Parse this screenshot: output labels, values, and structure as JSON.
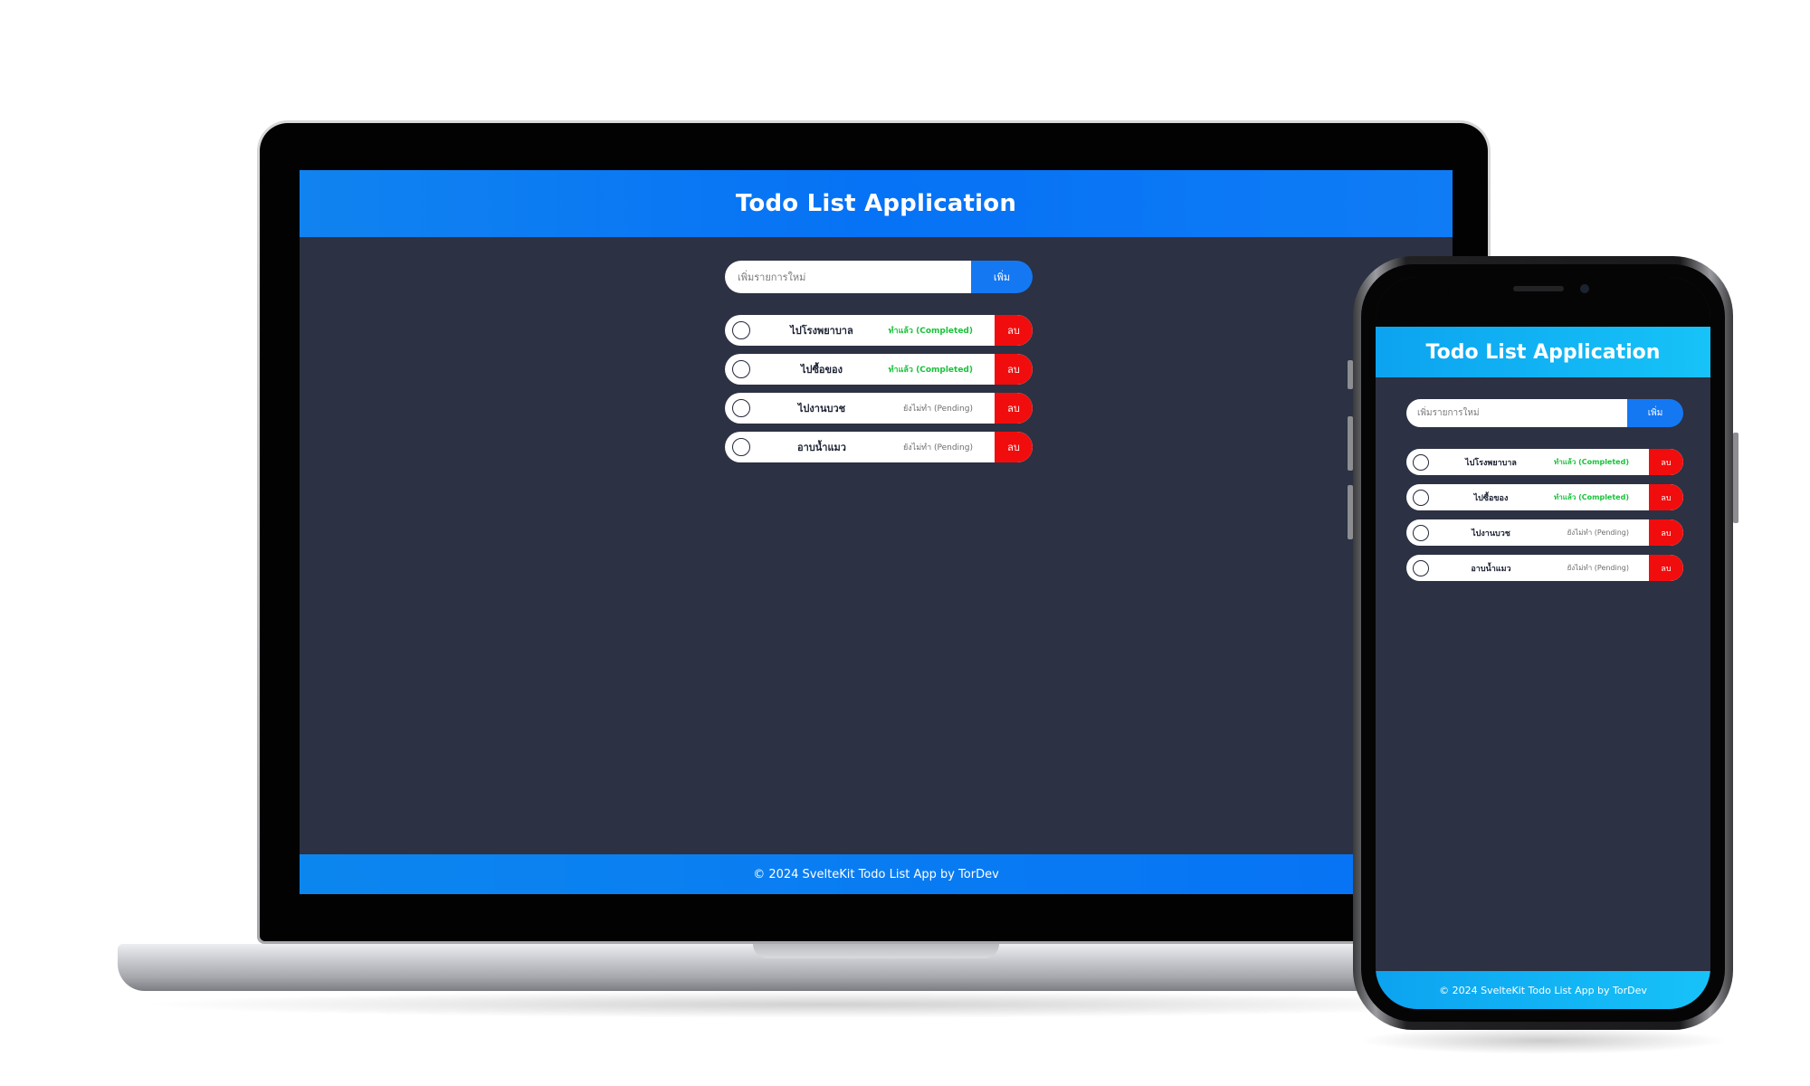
{
  "app": {
    "title": "Todo List Application",
    "footer": "© 2024 SvelteKit Todo List App by TorDev",
    "add_placeholder": "เพิ่มรายการใหม่",
    "add_button": "เพิ่ม",
    "delete_label": "ลบ",
    "colors": {
      "desktop_header": "#0672f5",
      "mobile_header": "#16c3f7",
      "background": "#2c3143",
      "delete": "#f10d0d",
      "completed": "#19c23a"
    }
  },
  "todos": [
    {
      "text": "ไปโรงพยาบาล",
      "status": "ทำแล้ว (Completed)",
      "completed": true
    },
    {
      "text": "ไปซื้อของ",
      "status": "ทำแล้ว (Completed)",
      "completed": true
    },
    {
      "text": "ไปงานบวช",
      "status": "ยังไม่ทำ (Pending)",
      "completed": false
    },
    {
      "text": "อาบน้ำแมว",
      "status": "ยังไม่ทำ (Pending)",
      "completed": false
    }
  ],
  "icons": {
    "check": "check-icon",
    "circle": "circle-icon"
  }
}
